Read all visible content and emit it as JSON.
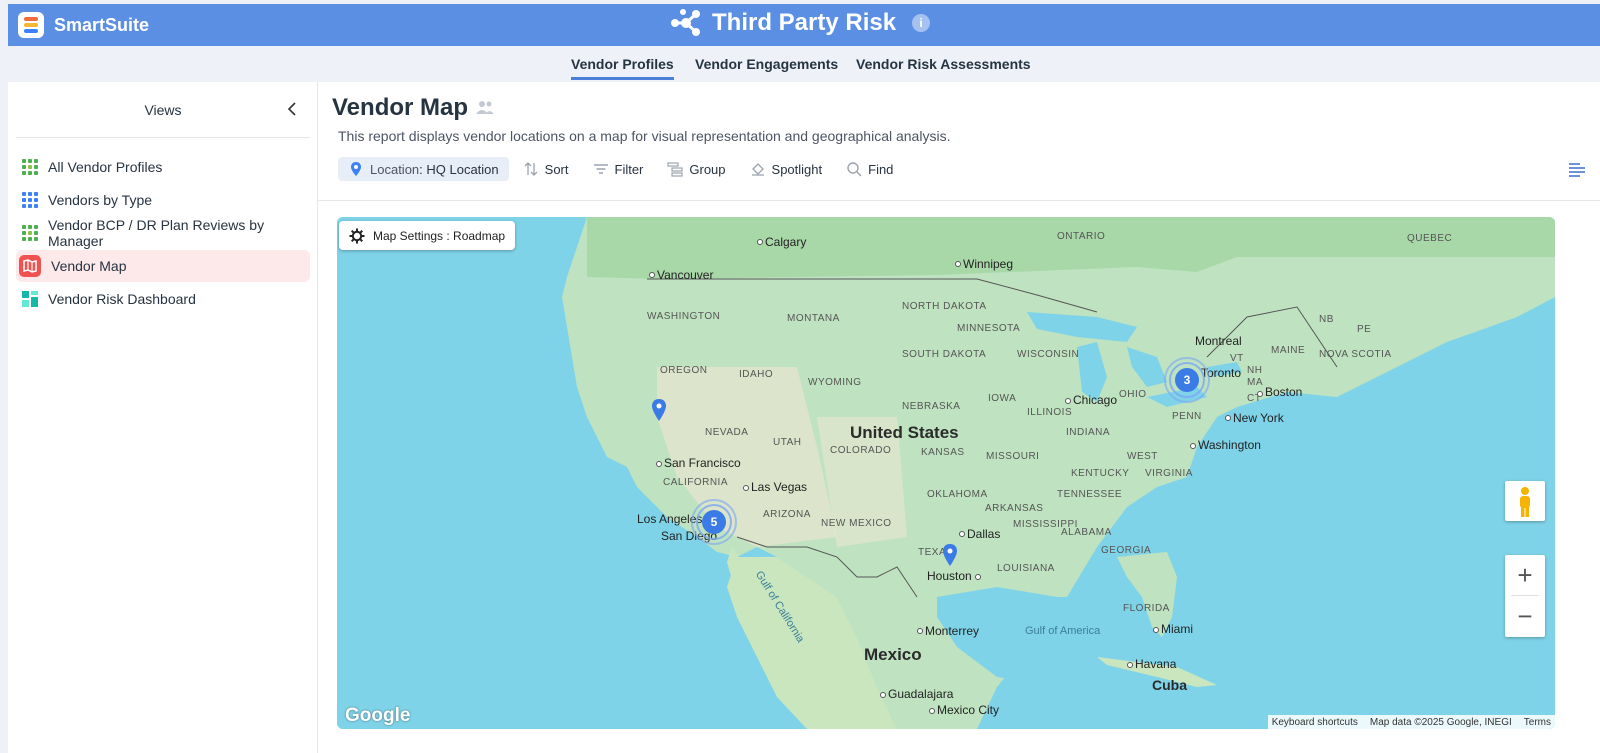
{
  "header": {
    "brand_name": "SmartSuite",
    "app_title": "Third Party Risk",
    "info": "i"
  },
  "tabs": [
    {
      "label": "Vendor Profiles",
      "active": true
    },
    {
      "label": "Vendor Engagements",
      "active": false
    },
    {
      "label": "Vendor Risk Assessments",
      "active": false
    }
  ],
  "sidebar": {
    "title": "Views",
    "items": [
      {
        "label": "All Vendor Profiles",
        "icon": "grid-green-icon"
      },
      {
        "label": "Vendors by Type",
        "icon": "grid-blue-icon"
      },
      {
        "label": "Vendor BCP / DR Plan Reviews by Manager",
        "icon": "grid-green-icon"
      },
      {
        "label": "Vendor Map",
        "icon": "map-icon",
        "active": true
      },
      {
        "label": "Vendor Risk Dashboard",
        "icon": "dashboard-icon"
      }
    ]
  },
  "main": {
    "title": "Vendor Map",
    "description": "This report displays vendor locations on a map for visual representation and geographical analysis.",
    "toolbar": {
      "location_prefix": "Location",
      "location_value": ": HQ Location",
      "sort": "Sort",
      "filter": "Filter",
      "group": "Group",
      "spotlight": "Spotlight",
      "find": "Find"
    }
  },
  "map": {
    "settings_label": "Map Settings : Roadmap",
    "country_labels": [
      "United States",
      "Mexico",
      "Cuba"
    ],
    "state_labels": [
      "ONTARIO",
      "QUEBEC",
      "WASHINGTON",
      "MONTANA",
      "NORTH DAKOTA",
      "MINNESOTA",
      "SOUTH DAKOTA",
      "WISCONSIN",
      "OREGON",
      "IDAHO",
      "WYOMING",
      "NEBRASKA",
      "IOWA",
      "ILLINOIS",
      "INDIANA",
      "OHIO",
      "PENN",
      "NEVADA",
      "UTAH",
      "COLORADO",
      "KANSAS",
      "MISSOURI",
      "KENTUCKY",
      "VIRGINIA",
      "WEST",
      "CALIFORNIA",
      "ARIZONA",
      "NEW MEXICO",
      "OKLAHOMA",
      "ARKANSAS",
      "TENNESSEE",
      "MISSISSIPPI",
      "ALABAMA",
      "GEORGIA",
      "TEXAS",
      "LOUISIANA",
      "FLORIDA",
      "NB",
      "PE",
      "NOVA SCOTIA",
      "MAINE",
      "VT",
      "MA",
      "CT",
      "NH"
    ],
    "city_labels": [
      "Calgary",
      "Winnipeg",
      "Vancouver",
      "Montreal",
      "Toronto",
      "Boston",
      "Chicago",
      "New York",
      "Washington",
      "San Francisco",
      "Las Vegas",
      "Los Angeles",
      "San Diego",
      "Dallas",
      "Houston",
      "Monterrey",
      "Miami",
      "Havana",
      "Guadalajara",
      "Mexico City"
    ],
    "sea_labels": [
      "Gulf of California",
      "Gulf of America"
    ],
    "clusters": [
      {
        "count": "5",
        "place": "Los Angeles"
      },
      {
        "count": "3",
        "place": "Toronto"
      }
    ],
    "pins": [
      "Northern California",
      "Texas"
    ],
    "zoom_in": "+",
    "zoom_out": "−",
    "logo": "Google",
    "attribution": {
      "shortcuts": "Keyboard shortcuts",
      "data": "Map data ©2025 Google, INEGI",
      "terms": "Terms"
    }
  },
  "colors": {
    "header": "#5b8fe3",
    "accent": "#4a7fd8",
    "active_view": "#fde8ea",
    "water": "#7fd3e8",
    "land": "#bfe3c1",
    "cluster": "#3b7be6"
  }
}
